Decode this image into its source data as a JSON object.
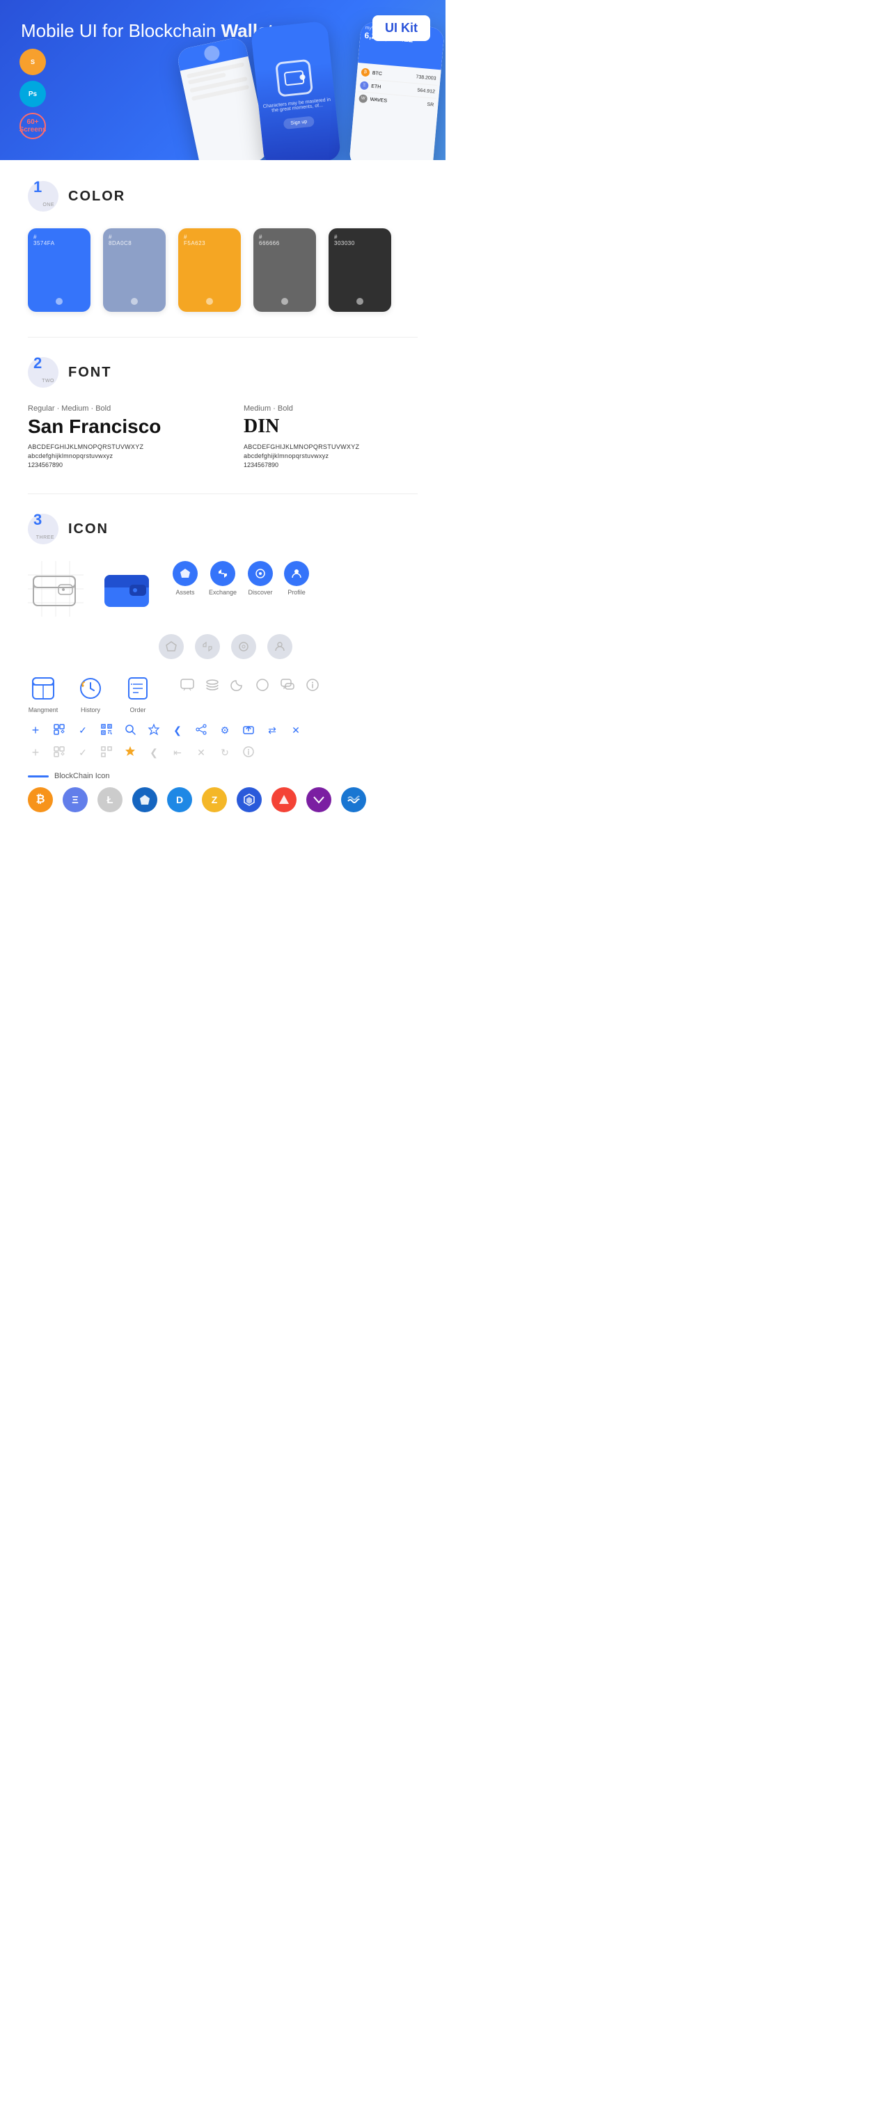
{
  "hero": {
    "title": "Mobile UI for Blockchain ",
    "title_bold": "Wallet",
    "badge": "UI Kit",
    "icons": [
      {
        "label": "Sketch",
        "type": "sketch"
      },
      {
        "label": "PS",
        "type": "ps"
      },
      {
        "label": "60+ Screens",
        "type": "screens"
      }
    ]
  },
  "sections": {
    "color": {
      "number": "1",
      "number_word": "ONE",
      "title": "COLOR",
      "swatches": [
        {
          "hex": "#3574FA",
          "label": "3574FA"
        },
        {
          "hex": "#8DA0C8",
          "label": "8DA0C8"
        },
        {
          "hex": "#F5A623",
          "label": "F5A623"
        },
        {
          "hex": "#666666",
          "label": "666666"
        },
        {
          "hex": "#303030",
          "label": "303030"
        }
      ]
    },
    "font": {
      "number": "2",
      "number_word": "TWO",
      "title": "FONT",
      "fonts": [
        {
          "style_label": "Regular · Medium · Bold",
          "name": "San Francisco",
          "uppercase": "ABCDEFGHIJKLMNOPQRSTUVWXYZ",
          "lowercase": "abcdefghijklmnopqrstuvwxyz",
          "numbers": "1234567890"
        },
        {
          "style_label": "Medium · Bold",
          "name": "DIN",
          "uppercase": "ABCDEFGHIJKLMNOPQRSTUVWXYZ",
          "lowercase": "abcdefghijklmnopqrstuvwxyz",
          "numbers": "1234567890"
        }
      ]
    },
    "icon": {
      "number": "3",
      "number_word": "THREE",
      "title": "ICON",
      "nav_icons": [
        {
          "label": "Assets",
          "icon": "◆"
        },
        {
          "label": "Exchange",
          "icon": "⇌"
        },
        {
          "label": "Discover",
          "icon": "⊙"
        },
        {
          "label": "Profile",
          "icon": "⌒"
        }
      ],
      "app_icons": [
        {
          "label": "Mangment",
          "icon": "management"
        },
        {
          "label": "History",
          "icon": "history"
        },
        {
          "label": "Order",
          "icon": "order"
        }
      ],
      "misc_icons": [
        "✦",
        "⊞",
        "✓",
        "⊟",
        "🔍",
        "☆",
        "❮",
        "⇤",
        "⚙",
        "⬒",
        "⇄",
        "✕"
      ],
      "blockchain_label": "BlockChain Icon",
      "crypto_coins": [
        {
          "symbol": "₿",
          "color": "#F7931A",
          "bg": "#FFF3E0",
          "label": "BTC"
        },
        {
          "symbol": "Ξ",
          "color": "#627EEA",
          "bg": "#E8EBFF",
          "label": "ETH"
        },
        {
          "symbol": "Ł",
          "color": "#888",
          "bg": "#f0f0f0",
          "label": "LTC"
        },
        {
          "symbol": "◆",
          "color": "#1E88E5",
          "bg": "#E3F2FD",
          "label": "Stratis"
        },
        {
          "symbol": "D",
          "color": "#1E88E5",
          "bg": "#E3F2FD",
          "label": "DASH"
        },
        {
          "symbol": "Z",
          "color": "#333",
          "bg": "#eee",
          "label": "Zcash"
        },
        {
          "symbol": "◈",
          "color": "#3574FA",
          "bg": "#E8F0FF",
          "label": "Qtum"
        },
        {
          "symbol": "▲",
          "color": "#2952d9",
          "bg": "#E8F0FF",
          "label": "Ark"
        },
        {
          "symbol": "◇",
          "color": "#7B1FA2",
          "bg": "#F3E5F5",
          "label": "Verge"
        },
        {
          "symbol": "∞",
          "color": "#1976D2",
          "bg": "#E3F2FD",
          "label": "Waves"
        }
      ]
    }
  }
}
